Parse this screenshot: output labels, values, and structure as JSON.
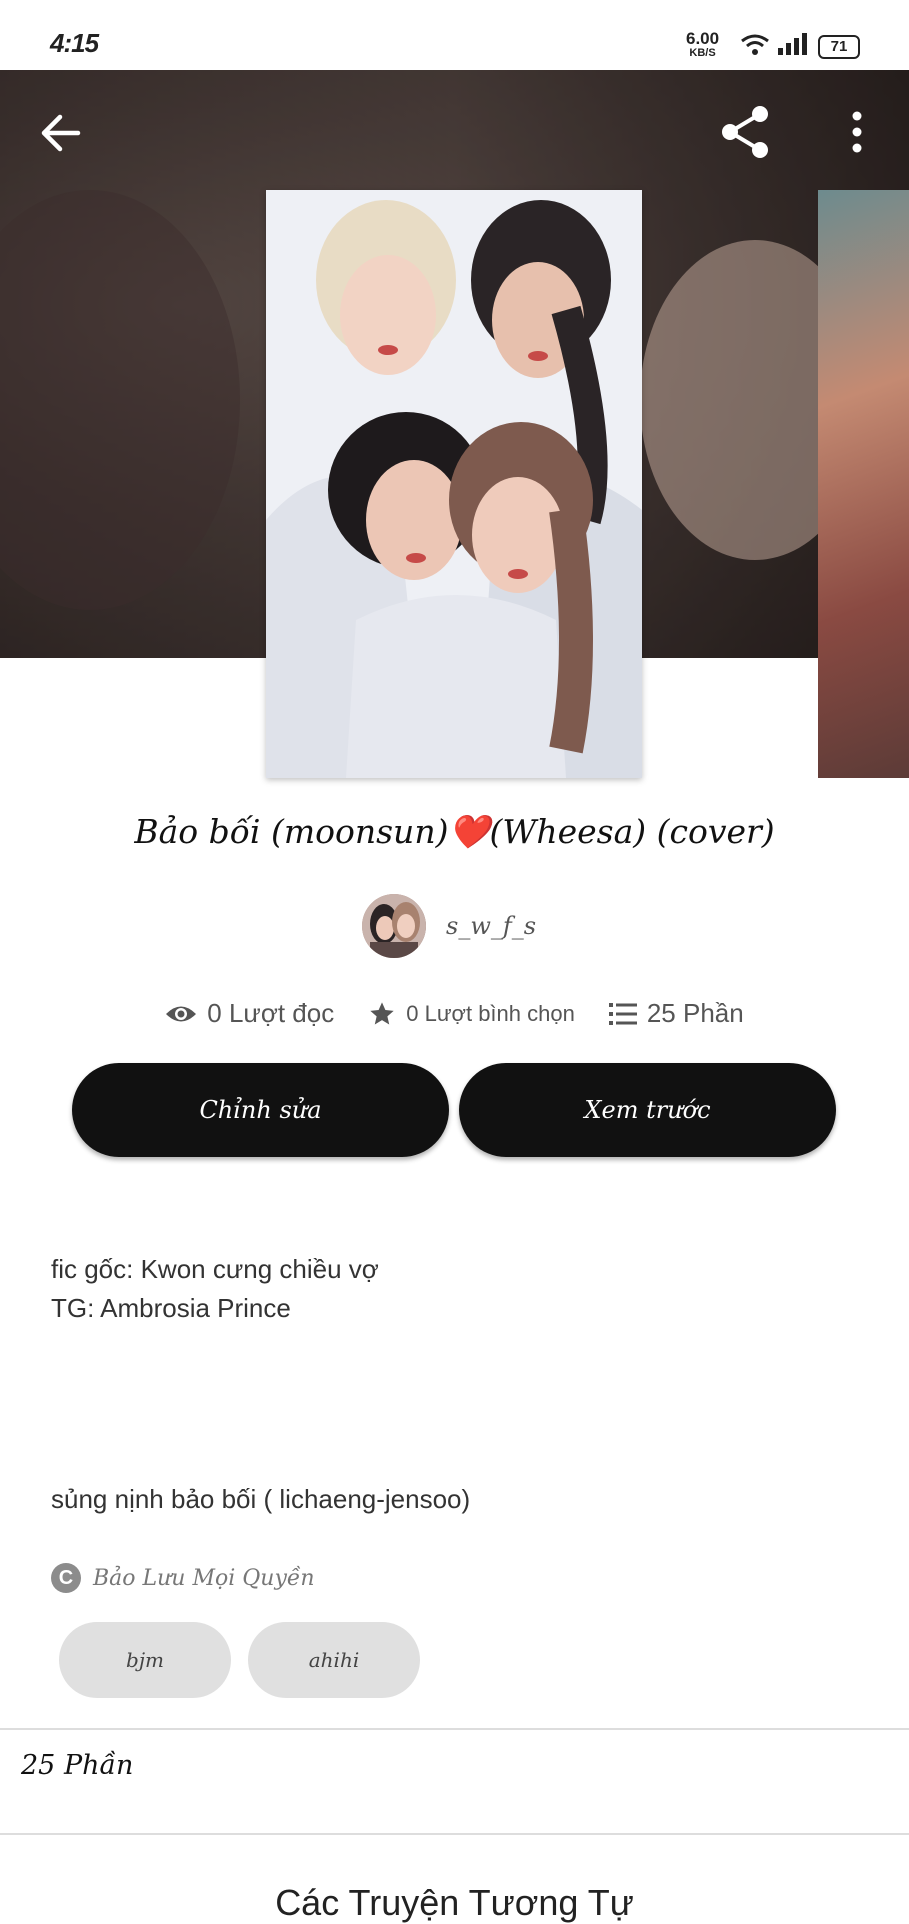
{
  "status_bar": {
    "time": "4:15",
    "net_speed_value": "6.00",
    "net_speed_unit": "KB/S",
    "battery": "71"
  },
  "toolbar": {
    "back_icon": "arrow-left-icon",
    "share_icon": "share-icon",
    "more_icon": "more-vertical-icon"
  },
  "story": {
    "title": "Bảo bối (moonsun)❤️(Wheesa) (cover)",
    "author": "s_w_f_s",
    "stats": {
      "reads": "0 Lượt đọc",
      "votes": "0 Lượt bình chọn",
      "parts": "25 Phần"
    },
    "description_line1": "fic gốc: Kwon cưng chiều vợ",
    "description_line2": "TG: Ambrosia Prince",
    "description_line3": "sủng nịnh bảo bối ( lichaeng-jensoo)",
    "copyright": "Bảo Lưu Mọi Quyền",
    "tags": [
      "bjm",
      "ahihi"
    ]
  },
  "buttons": {
    "edit": "Chỉnh sửa",
    "preview": "Xem trước"
  },
  "sections": {
    "parts_heading": "25 Phần",
    "similar_heading": "Các Truyện Tương Tự"
  }
}
